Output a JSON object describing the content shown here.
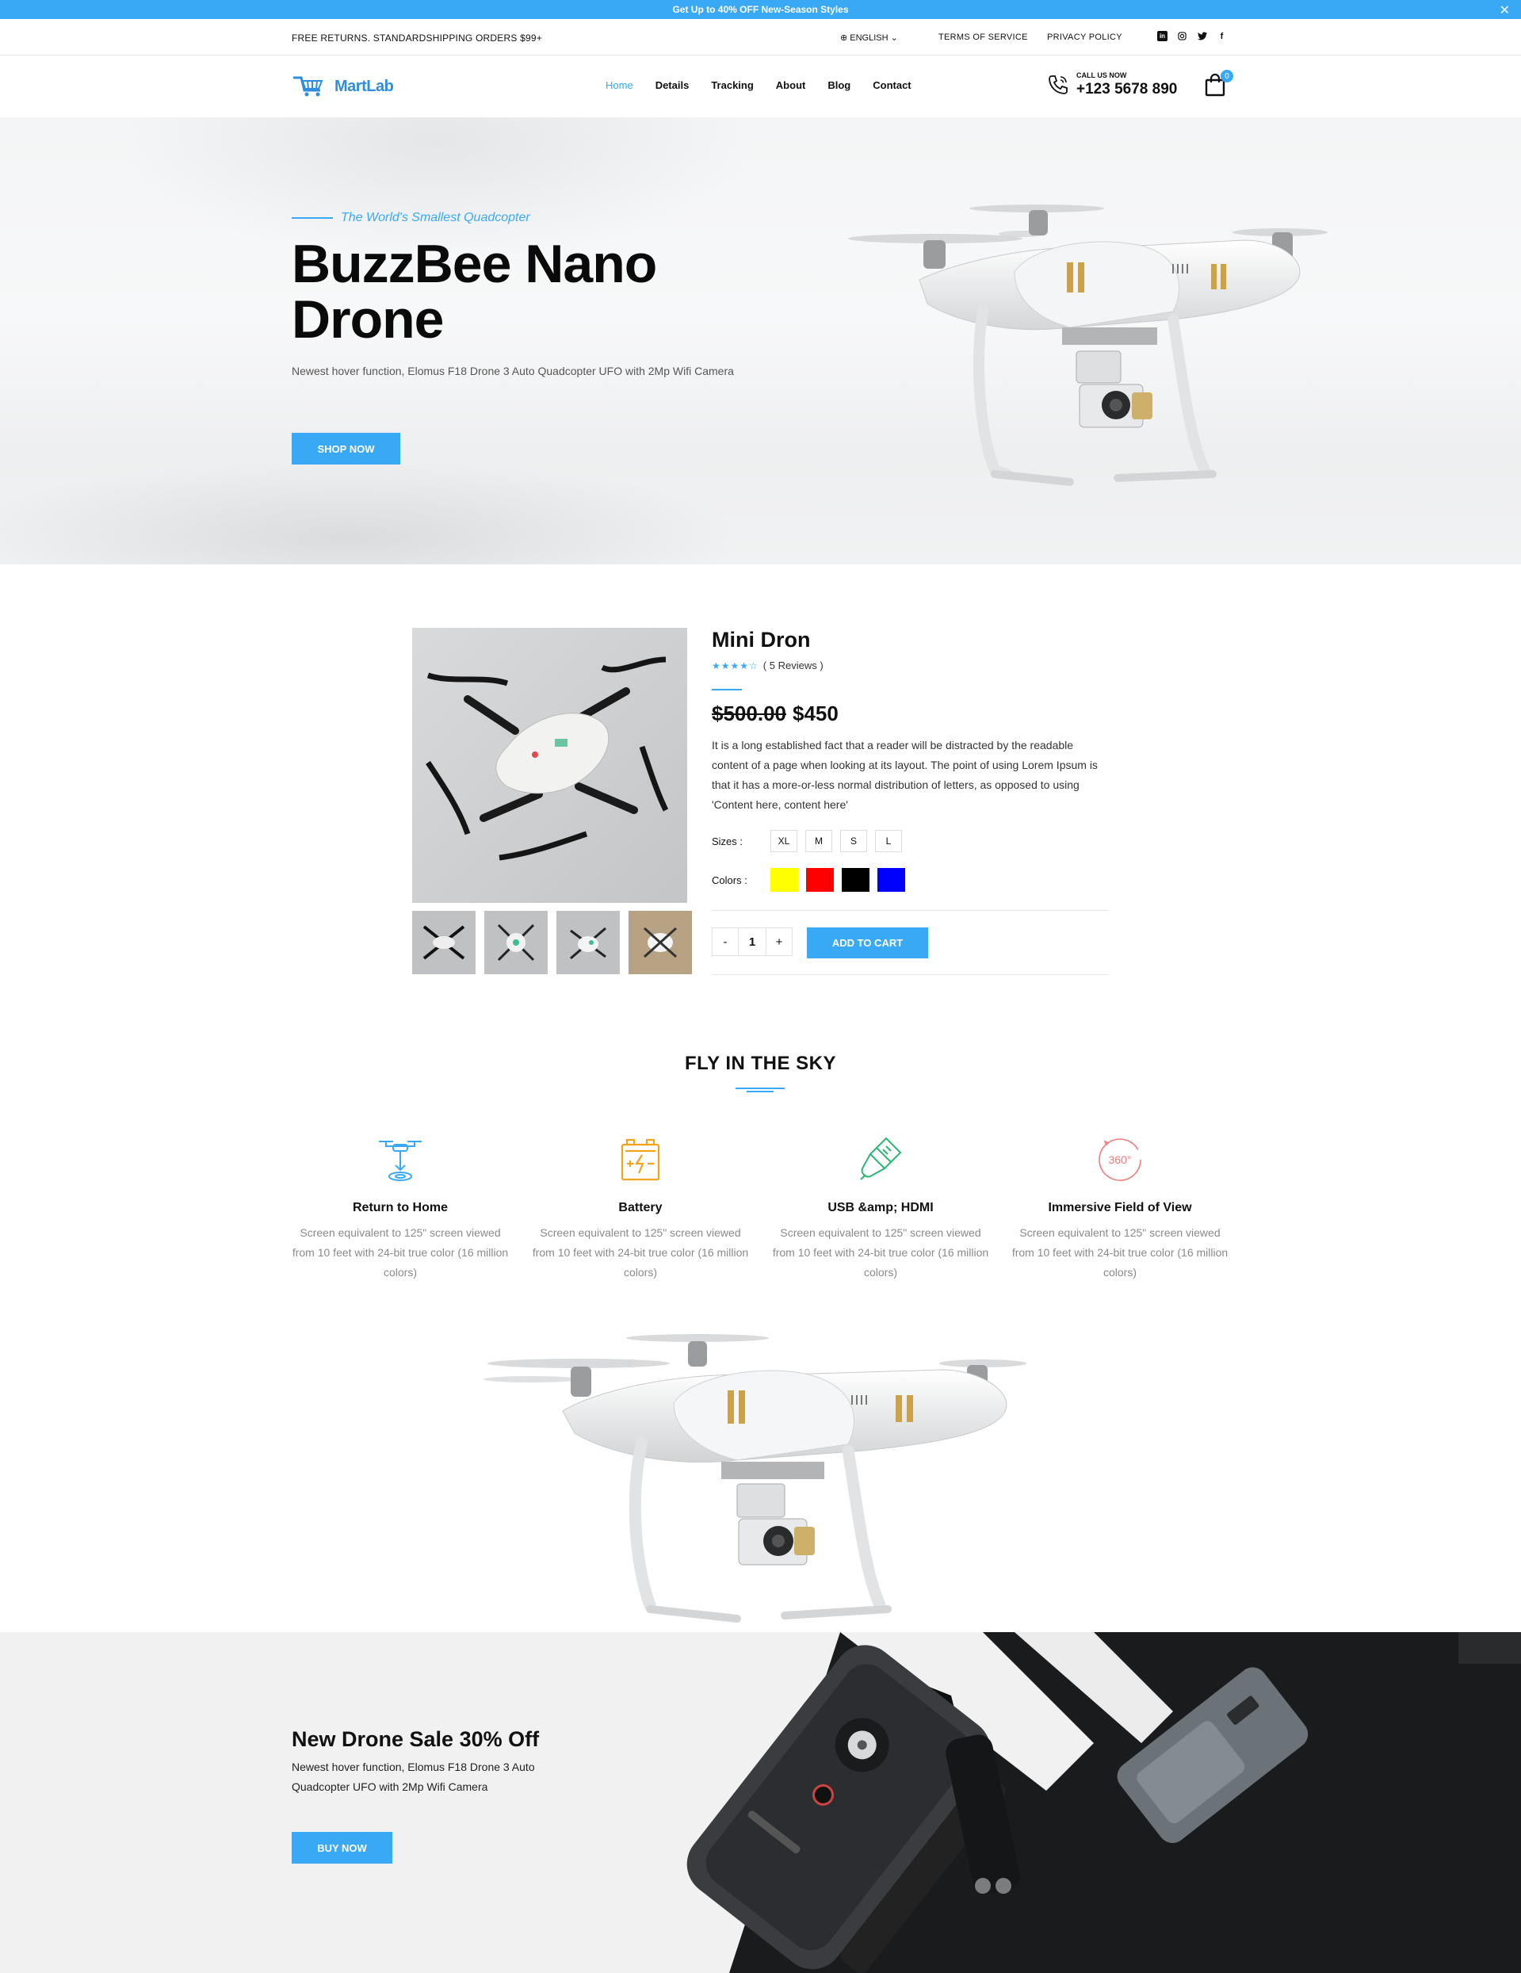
{
  "announcement": {
    "text": "Get Up to 40% OFF New-Season Styles",
    "close_icon": "close-icon"
  },
  "topbar": {
    "shipping": "FREE RETURNS. STANDARDSHIPPING ORDERS $99+",
    "language": "ENGLISH",
    "terms": "TERMS OF SERVICE",
    "privacy": "PRIVACY POLICY",
    "social_icons": [
      "linkedin-icon",
      "instagram-icon",
      "twitter-icon",
      "facebook-icon"
    ]
  },
  "header": {
    "logo": "MartLab",
    "nav": [
      "Home",
      "Details",
      "Tracking",
      "About",
      "Blog",
      "Contact"
    ],
    "active_nav": "Home",
    "call_label": "CALL US NOW",
    "phone": "+123 5678 890",
    "cart_count": "0"
  },
  "hero": {
    "tagline": "The World's Smallest Quadcopter",
    "title": "BuzzBee Nano Drone",
    "description": "Newest hover function, Elomus F18 Drone 3 Auto Quadcopter UFO with 2Mp Wifi Camera",
    "button": "SHOP NOW"
  },
  "product": {
    "title": "Mini Dron",
    "stars": "★★★★☆",
    "reviews": "( 5 Reviews )",
    "rating_out_of_5": 3.5,
    "old_price": "$500.00",
    "price": "$450",
    "description": "It is a long established fact that a reader will be distracted by the readable content of a page when looking at its layout. The point of using Lorem Ipsum is that it has a more-or-less normal distribution of letters, as opposed to using 'Content here, content here'",
    "sizes_label": "Sizes :",
    "sizes": [
      "XL",
      "M",
      "S",
      "L"
    ],
    "colors_label": "Colors :",
    "colors": [
      "#ffff00",
      "#ff0000",
      "#000000",
      "#0000ff"
    ],
    "qty_minus": "-",
    "qty": "1",
    "qty_plus": "+",
    "add_to_cart": "ADD TO CART"
  },
  "features": {
    "heading": "FLY IN THE SKY",
    "items": [
      {
        "title": "Return to Home",
        "text": "Screen equivalent to 125\" screen viewed from 10 feet with 24-bit true color (16 million colors)",
        "icon": "drone-return-icon",
        "color": "#3aa9f5"
      },
      {
        "title": "Battery",
        "text": "Screen equivalent to 125\" screen viewed from 10 feet with 24-bit true color (16 million colors)",
        "icon": "battery-icon",
        "color": "#f2a21b"
      },
      {
        "title": "USB &amp; HDMI",
        "text": "Screen equivalent to 125\" screen viewed from 10 feet with 24-bit true color (16 million colors)",
        "icon": "usb-icon",
        "color": "#2bb673"
      },
      {
        "title": "Immersive Field of View",
        "text": "Screen equivalent to 125\" screen viewed from 10 feet with 24-bit true color (16 million colors)",
        "icon": "360-icon",
        "color": "#f07b7b",
        "icon_text": "360°"
      }
    ]
  },
  "sale": {
    "title": "New Drone Sale 30% Off",
    "description": "Newest hover function, Elomus F18 Drone 3 Auto Quadcopter UFO with 2Mp Wifi Camera",
    "button": "BUY NOW"
  }
}
